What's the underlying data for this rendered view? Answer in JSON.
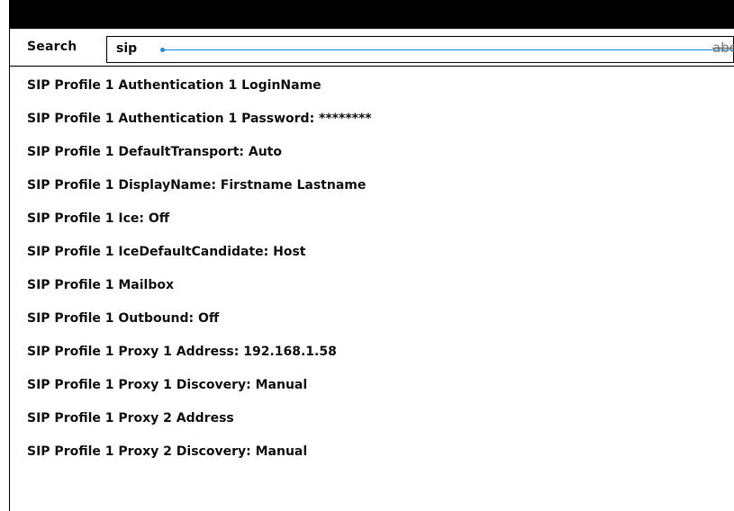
{
  "search": {
    "label": "Search",
    "value": "sip",
    "keyboard_hint": "abc"
  },
  "colors": {
    "accent": "#1a8fd6",
    "topbar": "#000000"
  },
  "results": [
    "SIP Profile 1 Authentication 1 LoginName",
    "SIP Profile 1 Authentication 1 Password: ********",
    "SIP Profile 1 DefaultTransport: Auto",
    "SIP Profile 1 DisplayName: Firstname Lastname",
    "SIP Profile 1 Ice: Off",
    "SIP Profile 1 IceDefaultCandidate: Host",
    "SIP Profile 1 Mailbox",
    "SIP Profile 1 Outbound: Off",
    "SIP Profile 1 Proxy 1 Address: 192.168.1.58",
    "SIP Profile 1 Proxy 1 Discovery: Manual",
    "SIP Profile 1 Proxy 2 Address",
    "SIP Profile 1 Proxy 2 Discovery: Manual"
  ]
}
